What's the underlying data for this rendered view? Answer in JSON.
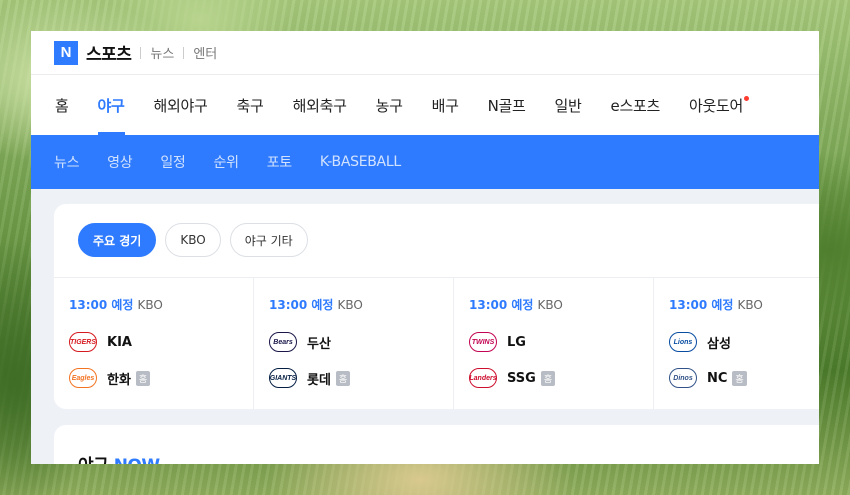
{
  "header": {
    "logo": "N",
    "brand": "스포츠",
    "links": [
      "뉴스",
      "엔터"
    ]
  },
  "main_nav": {
    "items": [
      "홈",
      "야구",
      "해외야구",
      "축구",
      "해외축구",
      "농구",
      "배구",
      "N골프",
      "일반",
      "e스포츠",
      "아웃도어"
    ],
    "active": "야구"
  },
  "sub_nav": {
    "items": [
      "뉴스",
      "영상",
      "일정",
      "순위",
      "포토",
      "K-BASEBALL"
    ]
  },
  "schedule": {
    "tabs": [
      "주요 경기",
      "KBO",
      "야구 기타"
    ],
    "active_tab": "주요 경기",
    "home_badge": "홈",
    "games": [
      {
        "time": "13:00 예정",
        "league": "KBO",
        "away": {
          "name": "KIA",
          "emblem_text": "TIGERS",
          "color": "#d6191e"
        },
        "home": {
          "name": "한화",
          "emblem_text": "Eagles",
          "color": "#f37321"
        }
      },
      {
        "time": "13:00 예정",
        "league": "KBO",
        "away": {
          "name": "두산",
          "emblem_text": "Bears",
          "color": "#1a1748"
        },
        "home": {
          "name": "롯데",
          "emblem_text": "GIANTS",
          "color": "#041e42"
        }
      },
      {
        "time": "13:00 예정",
        "league": "KBO",
        "away": {
          "name": "LG",
          "emblem_text": "TWINS",
          "color": "#c30452"
        },
        "home": {
          "name": "SSG",
          "emblem_text": "Landers",
          "color": "#ce0e2d"
        }
      },
      {
        "time": "13:00 예정",
        "league": "KBO",
        "away": {
          "name": "삼성",
          "emblem_text": "Lions",
          "color": "#074ca1"
        },
        "home": {
          "name": "NC",
          "emblem_text": "Dinos",
          "color": "#315288"
        }
      }
    ]
  },
  "now_section": {
    "title_prefix": "야구",
    "title_highlight": "NOW"
  },
  "colors": {
    "accent": "#2f7bff",
    "notification_dot": "#ff3b30"
  }
}
